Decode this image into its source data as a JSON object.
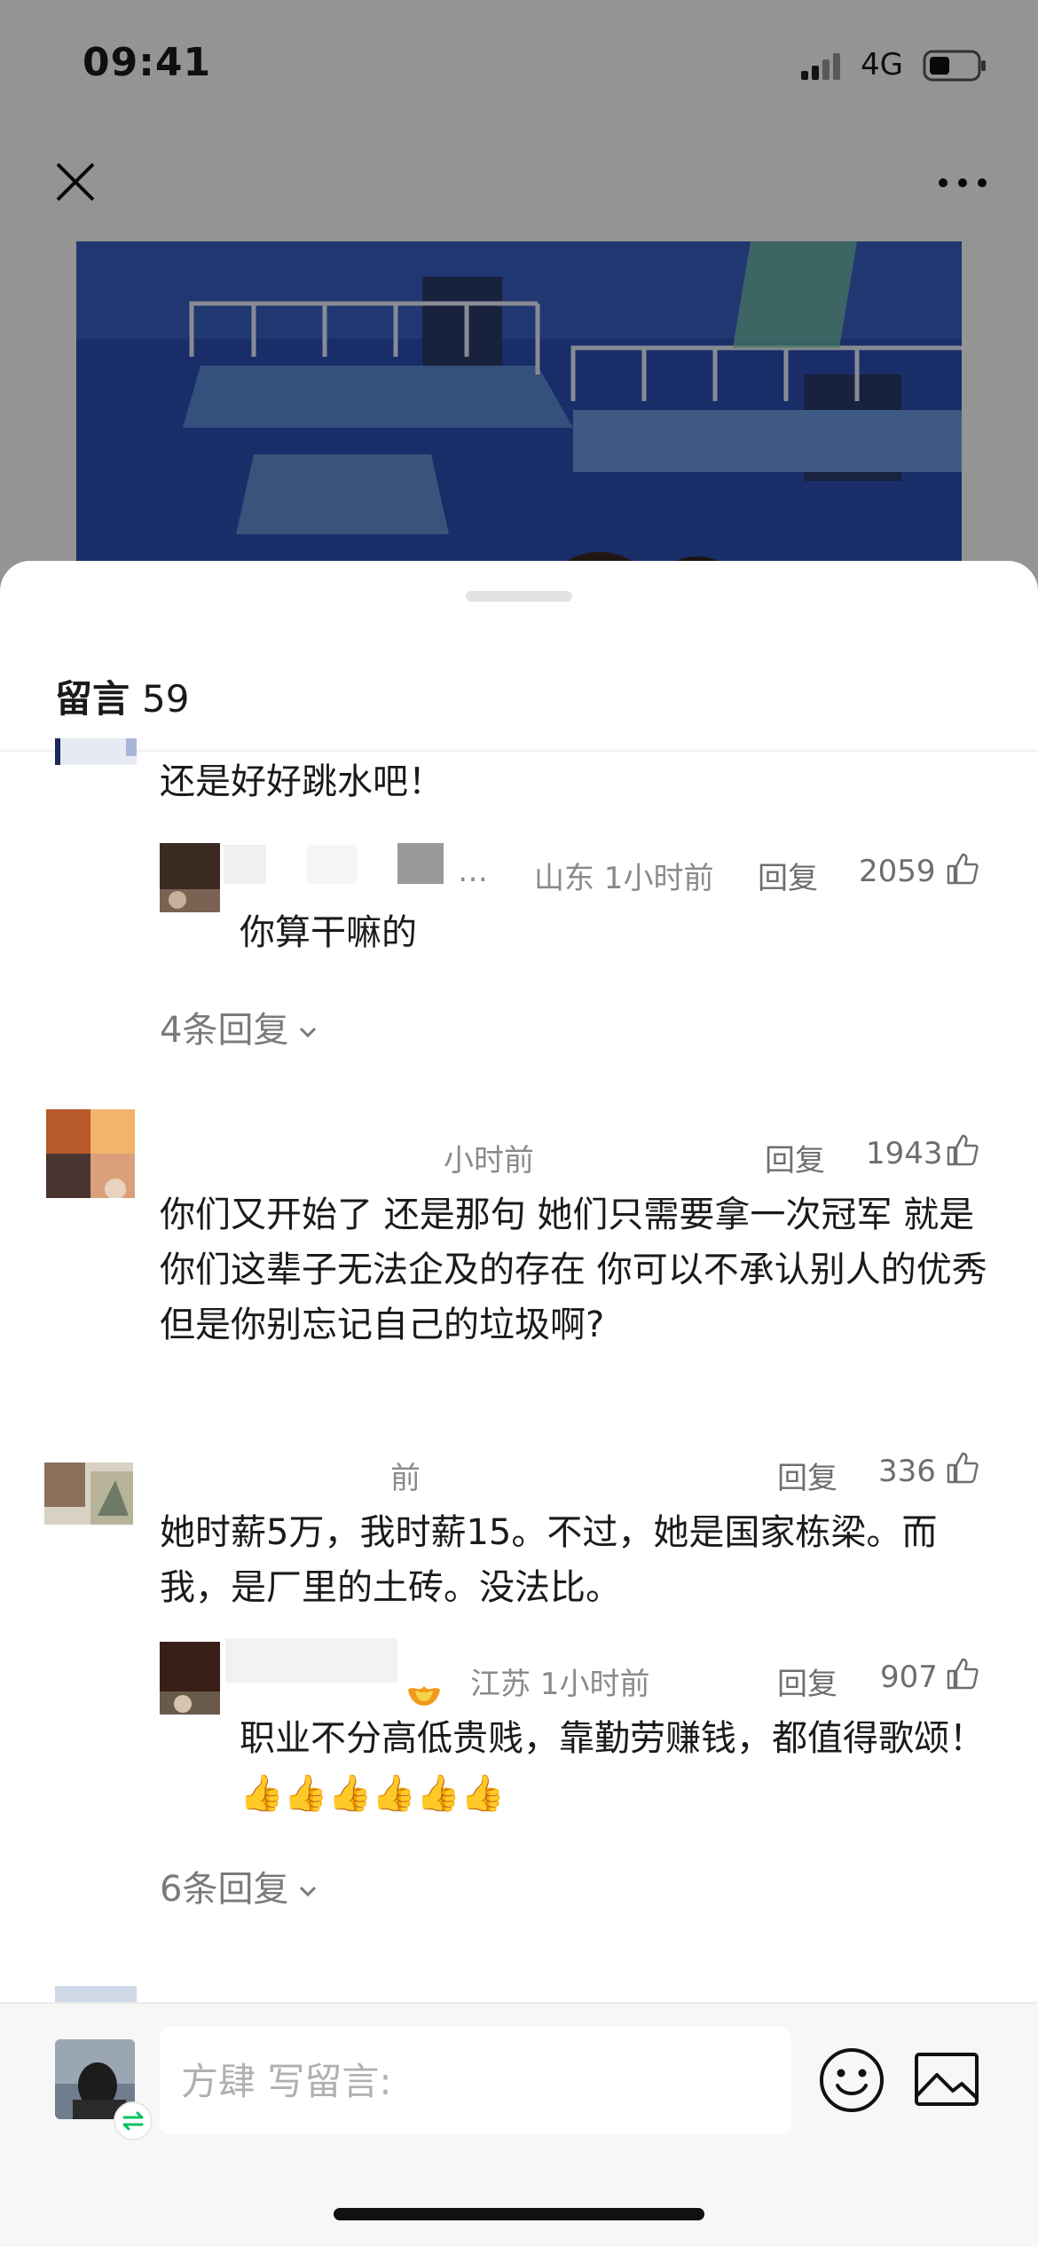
{
  "status_bar": {
    "time": "09:41",
    "network": "4G"
  },
  "sheet": {
    "title": "留言",
    "count": "59"
  },
  "comments": [
    {
      "text": "还是好好跳水吧！",
      "replies": [
        {
          "meta": "山东 1小时前",
          "ellipsis": "…",
          "reply_label": "回复",
          "likes": "2059",
          "text": "你算干嘛的"
        }
      ],
      "more_replies": "4条回复"
    },
    {
      "meta": "小时前",
      "reply_label": "回复",
      "likes": "1943",
      "text": "你们又开始了 还是那句 她们只需要拿一次冠军 就是你们这辈子无法企及的存在 你可以不承认别人的优秀 但是你别忘记自己的垃圾啊?"
    },
    {
      "meta": "前",
      "reply_label": "回复",
      "likes": "336",
      "text": "她时薪5万，我时薪15。不过，她是国家栋梁。而我，是厂里的土砖。没法比。",
      "replies": [
        {
          "meta": "江苏 1小时前",
          "reply_label": "回复",
          "likes": "907",
          "text": "职业不分高低贵贱，靠勤劳赚钱，都值得歌颂！👍👍👍👍👍👍"
        }
      ],
      "more_replies": "6条回复"
    }
  ],
  "input": {
    "placeholder": "方肆 写留言:"
  },
  "icons": [
    "close-icon",
    "more-icon",
    "thumbs-up-icon",
    "chevron-down-icon",
    "emoji-icon",
    "image-icon",
    "switch-account-icon",
    "signal-icon",
    "battery-icon"
  ],
  "colors": {
    "accent_green": "#07c160",
    "meta_gray": "#8a8a8a"
  }
}
